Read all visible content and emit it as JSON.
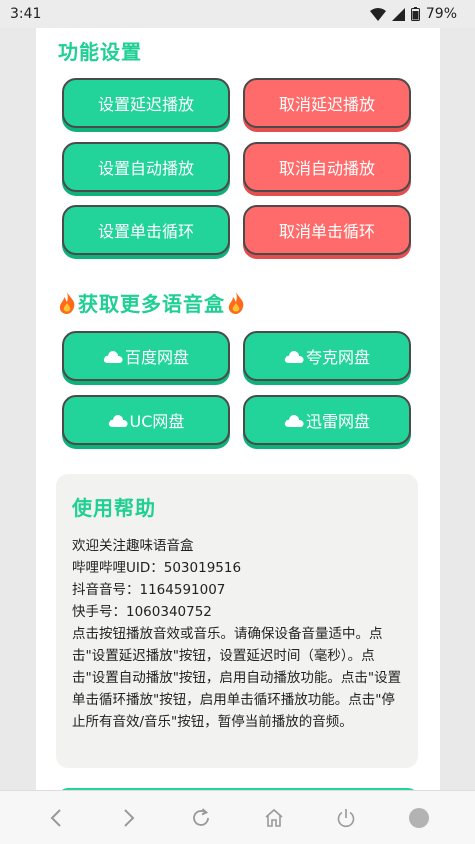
{
  "status": {
    "time": "3:41",
    "battery": "79%"
  },
  "settings": {
    "title": "功能设置",
    "set_delay": "设置延迟播放",
    "cancel_delay": "取消延迟播放",
    "set_auto": "设置自动播放",
    "cancel_auto": "取消自动播放",
    "set_loop": "设置单击循环",
    "cancel_loop": "取消单击循环"
  },
  "more": {
    "title": "获取更多语音盒",
    "baidu": "百度网盘",
    "quark": "夸克网盘",
    "uc": "UC网盘",
    "xunlei": "迅雷网盘"
  },
  "help": {
    "title": "使用帮助",
    "lines": [
      "欢迎关注趣味语音盒",
      "哔哩哔哩UID：503019516",
      "抖音音号：1164591007",
      "快手号：1060340752",
      "点击按钮播放音效或音乐。请确保设备音量适中。点击\"设置延迟播放\"按钮，设置延迟时间（毫秒）。点击\"设置自动播放\"按钮，启用自动播放功能。点击\"设置单击循环播放\"按钮，启用单击循环播放功能。点击\"停止所有音效/音乐\"按钮，暂停当前播放的音频。"
    ]
  },
  "colors": {
    "accent": "#1fcf93",
    "green_button": "#22d39a",
    "red_button": "#ff6b6b"
  },
  "icons": {
    "nav": [
      "back-icon",
      "forward-icon",
      "reload-icon",
      "home-icon",
      "power-icon",
      "circle-icon"
    ],
    "status": [
      "wifi-icon",
      "signal-icon",
      "battery-icon"
    ]
  }
}
